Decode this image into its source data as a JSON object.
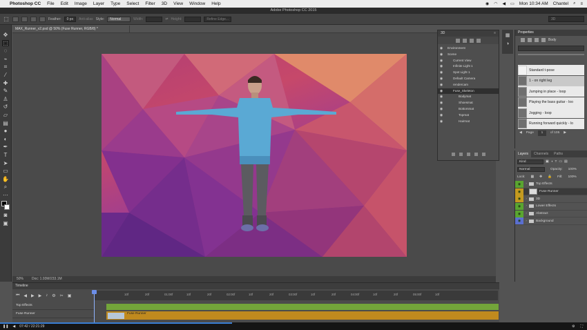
{
  "menubar": {
    "app_name": "Photoshop CC",
    "items": [
      "File",
      "Edit",
      "Image",
      "Layer",
      "Type",
      "Select",
      "Filter",
      "3D",
      "View",
      "Window",
      "Help"
    ],
    "clock": "Mon 10:34 AM",
    "user": "Chantel"
  },
  "app_title": "Adobe Photoshop CC 2015",
  "options": {
    "feather_label": "Feather:",
    "feather_value": "0 px",
    "antialias_label": "Anti-alias",
    "style_label": "Style:",
    "style_value": "Normal",
    "width_label": "Width:",
    "height_label": "Height:",
    "refine_edge": "Refine Edge..."
  },
  "document": {
    "tab_title": "MAX_Runner_v2.psd @ 50% (Fuse Runner, RGB/8) *",
    "zoom": "50%",
    "doc_size": "Doc: 1.93M/233.1M"
  },
  "panel_3d": {
    "title": "3D",
    "items": [
      {
        "label": "Environment",
        "indent": 1,
        "selected": false
      },
      {
        "label": "Scene",
        "indent": 1,
        "selected": false
      },
      {
        "label": "Current View",
        "indent": 2,
        "selected": false
      },
      {
        "label": "Infinite Light 1",
        "indent": 2,
        "selected": false
      },
      {
        "label": "Spot Light 1",
        "indent": 2,
        "selected": false
      },
      {
        "label": "Default Camera",
        "indent": 2,
        "selected": false
      },
      {
        "label": "rendercam",
        "indent": 2,
        "selected": false
      },
      {
        "label": "Fuse_Skeleton",
        "indent": 2,
        "selected": true
      },
      {
        "label": "Bodymat",
        "indent": 3,
        "selected": false
      },
      {
        "label": "Shoesmat",
        "indent": 3,
        "selected": false
      },
      {
        "label": "Bottommat",
        "indent": 3,
        "selected": false
      },
      {
        "label": "Topmat",
        "indent": 3,
        "selected": false
      },
      {
        "label": "Hairmat",
        "indent": 3,
        "selected": false
      }
    ]
  },
  "properties": {
    "title": "Properties",
    "sub_label": "Body",
    "mixamo": [
      {
        "label": "Standard t-pose",
        "active": false
      },
      {
        "label": "1 - on right leg",
        "active": true
      },
      {
        "label": "Jumping in place - loop",
        "active": false
      },
      {
        "label": "Playing the bass guitar - loo",
        "active": false
      },
      {
        "label": "Jogging - loop",
        "active": false
      },
      {
        "label": "Running forward quickly - lo",
        "active": false
      }
    ],
    "page_label": "Page",
    "page_value": "1",
    "page_total": "of 105"
  },
  "layers": {
    "tabs": [
      "Layers",
      "Channels",
      "Paths"
    ],
    "kind": "Kind",
    "blend_mode": "Normal",
    "opacity_label": "Opacity:",
    "opacity_value": "100%",
    "lock_label": "Lock:",
    "fill_label": "Fill:",
    "fill_value": "100%",
    "rows": [
      {
        "label": "Top Effects",
        "type": "folder",
        "eye": "green",
        "selected": false
      },
      {
        "label": "Fuse Runner",
        "type": "thumb",
        "eye": "gold",
        "selected": true
      },
      {
        "label": "3D",
        "type": "folder",
        "eye": "gold",
        "selected": false
      },
      {
        "label": "Lower Effects",
        "type": "folder",
        "eye": "green",
        "selected": false
      },
      {
        "label": "Abstract",
        "type": "folder",
        "eye": "green",
        "selected": false
      },
      {
        "label": "Background",
        "type": "folder",
        "eye": "blue",
        "selected": false
      }
    ]
  },
  "timeline": {
    "title": "Timeline",
    "ruler": [
      "10f",
      "20f",
      "01:00f",
      "10f",
      "20f",
      "02:00f",
      "10f",
      "20f",
      "03:00f",
      "10f",
      "20f",
      "04:00f",
      "10f",
      "20f",
      "05:00f",
      "10f"
    ],
    "tracks": [
      "Top Effects",
      "Fuse Runner"
    ],
    "clip_label": "Fuse Runner"
  },
  "media": {
    "time": "07:42 / 22:21:29"
  }
}
